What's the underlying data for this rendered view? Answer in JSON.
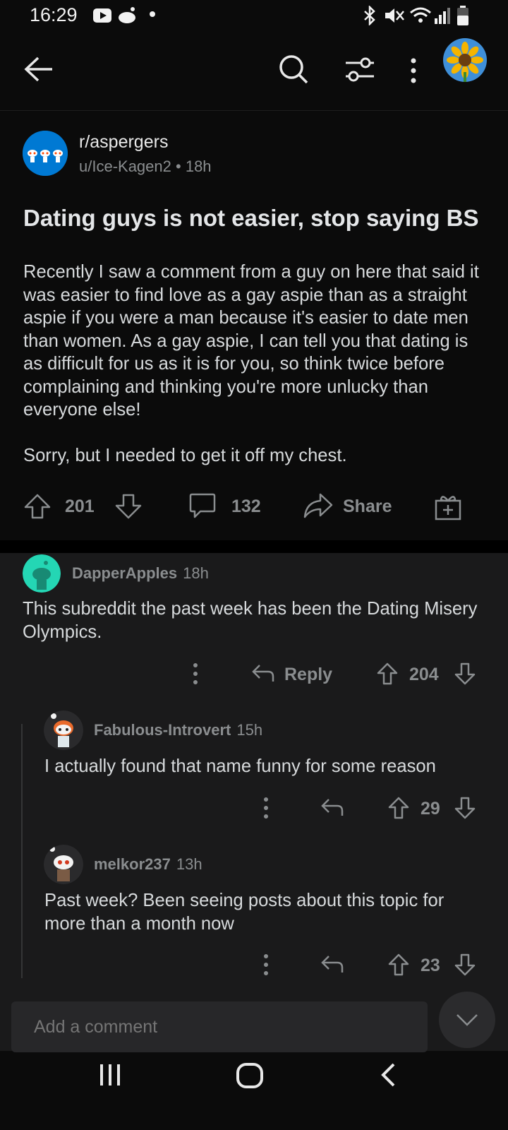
{
  "status_bar": {
    "time": "16:29"
  },
  "top_bar": {
    "back_icon": "arrow-left-icon",
    "search_icon": "search-icon",
    "sort_icon": "sort-filter-icon",
    "more_icon": "more-vertical-icon",
    "avatar_icon": "sunflower-avatar"
  },
  "post": {
    "subreddit": "r/aspergers",
    "author": "u/Ice-Kagen2",
    "separator": "•",
    "age": "18h",
    "title": "Dating guys is not easier, stop saying BS",
    "body": "Recently I saw a comment from a guy on here that said it was easier to find love as a gay aspie than as a straight aspie if you were a man because it's easier to date men than women. As a gay aspie, I can tell you that dating is as difficult for us as it is for you, so think twice before complaining and thinking you're more unlucky than everyone else!\n\nSorry, but I needed to get it off my chest.",
    "votes": "201",
    "comments_count": "132",
    "share_label": "Share"
  },
  "comments": [
    {
      "author": "DapperApples",
      "age": "18h",
      "body": "This subreddit the past week has been the Dating Misery Olympics.",
      "reply_label": "Reply",
      "votes": "204"
    },
    {
      "author": "Fabulous-Introvert",
      "age": "15h",
      "body": "I actually found that name funny for some reason",
      "votes": "29"
    },
    {
      "author": "melkor237",
      "age": "13h",
      "body": "Past week? Been seeing posts about this topic for more than a month now",
      "votes": "23"
    }
  ],
  "add_comment": {
    "placeholder": "Add a comment"
  },
  "colors": {
    "background": "#0b0b0b",
    "comment_bg": "#1a1a1b",
    "text": "#d7dadc",
    "muted": "#8a8d8f",
    "subreddit_blue": "#0079d3"
  }
}
